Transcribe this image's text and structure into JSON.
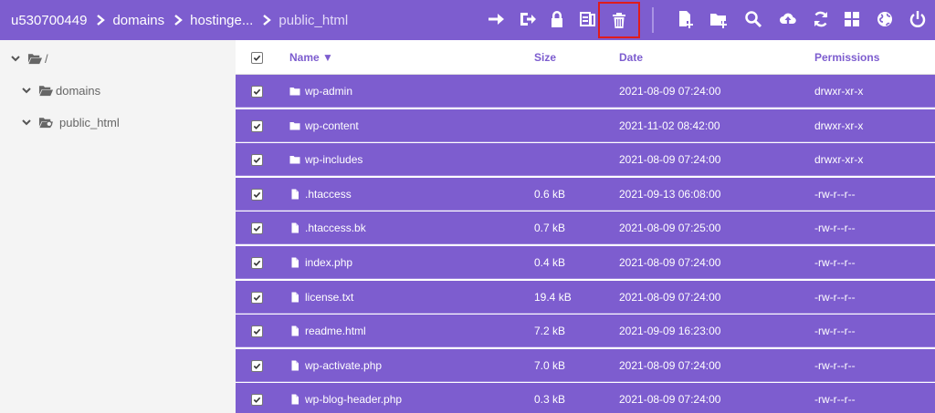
{
  "breadcrumb": [
    "u530700449",
    "domains",
    "hostinge...",
    "public_html"
  ],
  "toolbar": [
    {
      "icon": "arrow-right-icon",
      "label": "Go",
      "highlighted": false
    },
    {
      "icon": "sign-out-icon",
      "label": "Move",
      "highlighted": false
    },
    {
      "icon": "lock-icon",
      "label": "Permissions",
      "highlighted": false
    },
    {
      "icon": "archive-icon",
      "label": "Archive",
      "highlighted": false
    },
    {
      "icon": "trash-icon",
      "label": "Delete",
      "highlighted": true
    },
    {
      "icon": "new-file-icon",
      "label": "New file",
      "highlighted": false
    },
    {
      "icon": "new-folder-icon",
      "label": "New folder",
      "highlighted": false
    },
    {
      "icon": "search-icon",
      "label": "Search",
      "highlighted": false
    },
    {
      "icon": "upload-icon",
      "label": "Upload",
      "highlighted": false
    },
    {
      "icon": "refresh-icon",
      "label": "Refresh",
      "highlighted": false
    },
    {
      "icon": "grid-icon",
      "label": "Grid view",
      "highlighted": false
    },
    {
      "icon": "globe-icon",
      "label": "Open website",
      "highlighted": false
    },
    {
      "icon": "power-icon",
      "label": "Logout",
      "highlighted": false
    }
  ],
  "tree": [
    {
      "label": "/",
      "level": 0,
      "icon": "folder-open-icon"
    },
    {
      "label": "domains",
      "level": 1,
      "icon": "folder-open-icon"
    },
    {
      "label": "public_html",
      "level": 1,
      "icon": "folder-link-icon"
    }
  ],
  "columns": {
    "name": "Name ▼",
    "size": "Size",
    "date": "Date",
    "permissions": "Permissions"
  },
  "files": [
    {
      "name": "wp-admin",
      "type": "folder",
      "size": "",
      "date": "2021-08-09 07:24:00",
      "permissions": "drwxr-xr-x",
      "selected": true
    },
    {
      "name": "wp-content",
      "type": "folder",
      "size": "",
      "date": "2021-11-02 08:42:00",
      "permissions": "drwxr-xr-x",
      "selected": true
    },
    {
      "name": "wp-includes",
      "type": "folder",
      "size": "",
      "date": "2021-08-09 07:24:00",
      "permissions": "drwxr-xr-x",
      "selected": true
    },
    {
      "name": ".htaccess",
      "type": "file",
      "size": "0.6 kB",
      "date": "2021-09-13 06:08:00",
      "permissions": "-rw-r--r--",
      "selected": true
    },
    {
      "name": ".htaccess.bk",
      "type": "file",
      "size": "0.7 kB",
      "date": "2021-08-09 07:25:00",
      "permissions": "-rw-r--r--",
      "selected": true
    },
    {
      "name": "index.php",
      "type": "file",
      "size": "0.4 kB",
      "date": "2021-08-09 07:24:00",
      "permissions": "-rw-r--r--",
      "selected": true
    },
    {
      "name": "license.txt",
      "type": "file",
      "size": "19.4 kB",
      "date": "2021-08-09 07:24:00",
      "permissions": "-rw-r--r--",
      "selected": true
    },
    {
      "name": "readme.html",
      "type": "file",
      "size": "7.2 kB",
      "date": "2021-09-09 16:23:00",
      "permissions": "-rw-r--r--",
      "selected": true
    },
    {
      "name": "wp-activate.php",
      "type": "file",
      "size": "7.0 kB",
      "date": "2021-08-09 07:24:00",
      "permissions": "-rw-r--r--",
      "selected": true
    },
    {
      "name": "wp-blog-header.php",
      "type": "file",
      "size": "0.3 kB",
      "date": "2021-08-09 07:24:00",
      "permissions": "-rw-r--r--",
      "selected": true
    }
  ],
  "colors": {
    "accent": "#7d5dcf",
    "highlight": "#e01c1c",
    "sidebar": "#f4f4f4"
  }
}
